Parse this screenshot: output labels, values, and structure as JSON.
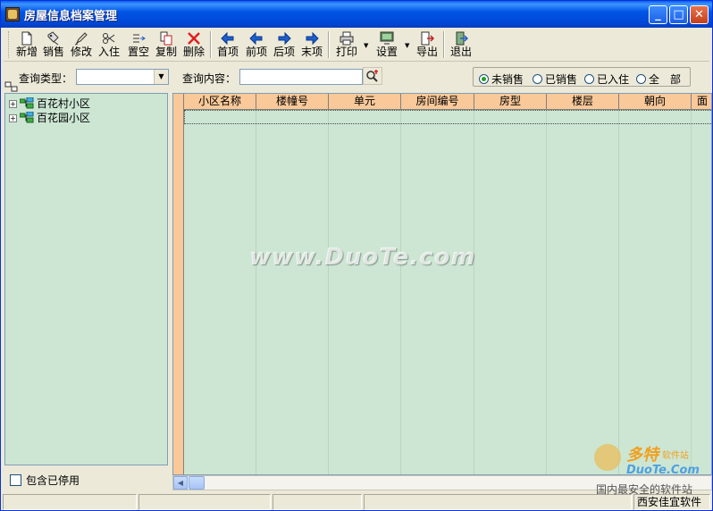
{
  "window": {
    "title": "房屋信息档案管理"
  },
  "title_buttons": {
    "minimize": "_",
    "maximize": "□",
    "close": "✕"
  },
  "toolbar": {
    "items": [
      {
        "label": "新增",
        "icon": "new-doc-icon"
      },
      {
        "label": "销售",
        "icon": "sell-icon"
      },
      {
        "label": "修改",
        "icon": "edit-icon"
      },
      {
        "label": "入住",
        "icon": "checkin-icon"
      },
      {
        "label": "置空",
        "icon": "clear-icon"
      },
      {
        "label": "复制",
        "icon": "copy-icon"
      },
      {
        "label": "删除",
        "icon": "delete-icon"
      },
      {
        "label": "首项",
        "icon": "first-arrow-icon"
      },
      {
        "label": "前项",
        "icon": "prev-arrow-icon"
      },
      {
        "label": "后项",
        "icon": "next-arrow-icon"
      },
      {
        "label": "末项",
        "icon": "last-arrow-icon"
      },
      {
        "label": "打印",
        "icon": "print-icon"
      },
      {
        "label": "设置",
        "icon": "settings-monitor-icon"
      },
      {
        "label": "导出",
        "icon": "export-icon"
      },
      {
        "label": "退出",
        "icon": "exit-icon"
      }
    ]
  },
  "query": {
    "type_label": "查询类型：",
    "type_value": "",
    "content_label": "查询内容：",
    "content_value": ""
  },
  "filter": {
    "options": [
      {
        "label": "未销售",
        "selected": true
      },
      {
        "label": "已销售",
        "selected": false
      },
      {
        "label": "已入住",
        "selected": false
      },
      {
        "label": "全　部",
        "selected": false
      }
    ]
  },
  "tree": {
    "items": [
      {
        "label": "百花村小区"
      },
      {
        "label": "百花园小区"
      }
    ]
  },
  "include_disabled": {
    "label": "包含已停用",
    "checked": false
  },
  "grid": {
    "columns": [
      "小区名称",
      "楼幢号",
      "单元",
      "房间编号",
      "房型",
      "楼层",
      "朝向",
      "面"
    ]
  },
  "statusbar": {
    "right_text": "西安佳宜软件"
  },
  "watermark": {
    "text": "www.DuoTe.com"
  },
  "corner_logo": {
    "brand": "多特",
    "sub": "软件站",
    "url": "DuoTe.Com",
    "tag": "国内最安全的软件站"
  },
  "colors": {
    "grid_bg": "#CCE6D3",
    "header_bg": "#FAC999",
    "titlebar": "#0055E5"
  }
}
